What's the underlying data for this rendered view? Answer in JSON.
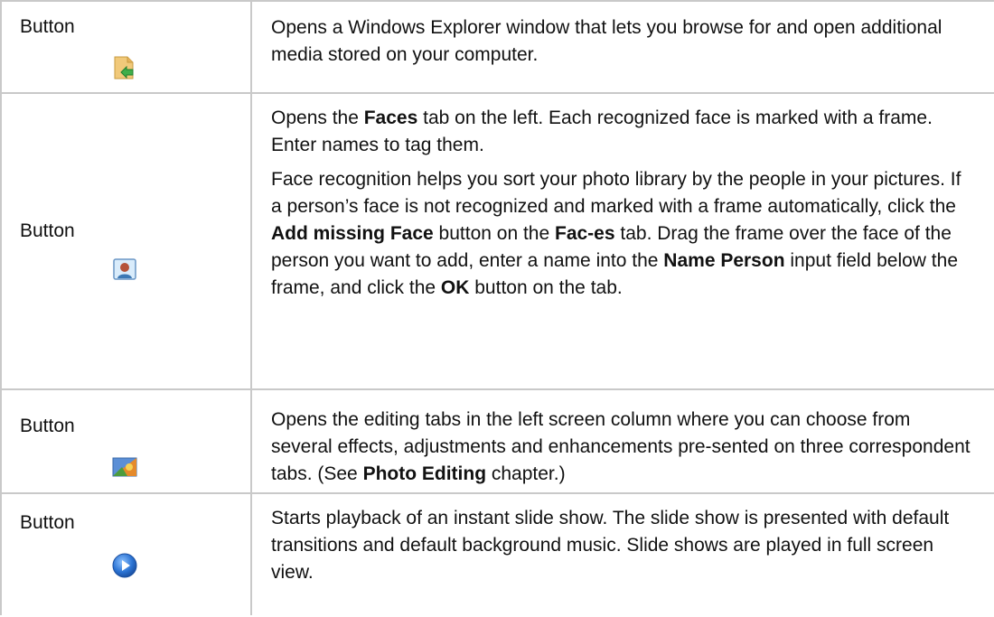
{
  "rows": [
    {
      "label": "Button",
      "icon": "open-media-folder-icon",
      "paragraphs": [
        [
          {
            "t": "Opens a Windows Explorer window that lets you browse for and open additional media stored on your computer.",
            "b": false
          }
        ]
      ]
    },
    {
      "label": "Button",
      "icon": "faces-person-icon",
      "paragraphs": [
        [
          {
            "t": "Opens the ",
            "b": false
          },
          {
            "t": "Faces",
            "b": true
          },
          {
            "t": " tab on the left. Each recognized face is marked with a frame. Enter names to tag them.",
            "b": false
          }
        ],
        [
          {
            "t": "Face recognition helps you sort your photo library by the people in your pictures. If a person’s face is not recognized and marked with a frame automatically, click the ",
            "b": false
          },
          {
            "t": "Add missing Face",
            "b": true
          },
          {
            "t": " button on the ",
            "b": false
          },
          {
            "t": "Fac-es",
            "b": true
          },
          {
            "t": " tab. Drag the frame over the face of the person you want to add, enter a name into the ",
            "b": false
          },
          {
            "t": "Name Person",
            "b": true
          },
          {
            "t": " input field below the frame, and click the ",
            "b": false
          },
          {
            "t": "OK",
            "b": true
          },
          {
            "t": " button on the tab.",
            "b": false
          }
        ]
      ]
    },
    {
      "label": "Button",
      "icon": "photo-editing-icon",
      "paragraphs": [
        [
          {
            "t": "Opens the editing tabs in the left screen column where you can choose from several effects, adjustments and enhancements pre-sented on three correspondent tabs. (See ",
            "b": false
          },
          {
            "t": "Photo Editing",
            "b": true
          },
          {
            "t": " chapter.)",
            "b": false
          }
        ]
      ]
    },
    {
      "label": "Button",
      "icon": "play-slideshow-icon",
      "paragraphs": [
        [
          {
            "t": "Starts playback of an instant slide show. The slide show is presented with default transitions and default background music. Slide shows are played in full screen view.",
            "b": false
          }
        ]
      ]
    }
  ]
}
